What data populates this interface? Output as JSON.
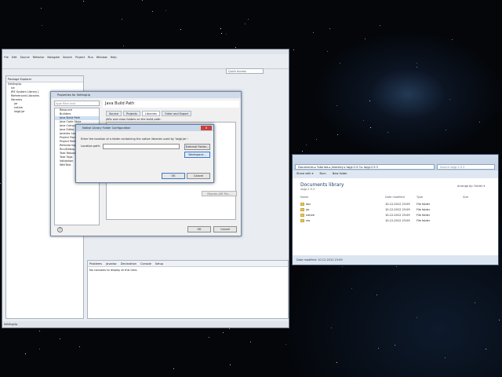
{
  "eclipse": {
    "menu": [
      "File",
      "Edit",
      "Source",
      "Refactor",
      "Navigate",
      "Search",
      "Project",
      "Run",
      "Window",
      "Help"
    ],
    "quick_access": "Quick Access",
    "package_explorer": {
      "title": "Package Explorer",
      "items": [
        {
          "label": "SettingUp",
          "indent": 2
        },
        {
          "label": "src",
          "indent": 6
        },
        {
          "label": "JRE System Library [",
          "indent": 6
        },
        {
          "label": "Referenced Libraries",
          "indent": 6
        },
        {
          "label": "libraries",
          "indent": 6
        },
        {
          "label": "jar",
          "indent": 10
        },
        {
          "label": "native",
          "indent": 10
        },
        {
          "label": "lwjgl.jar",
          "indent": 10
        }
      ]
    },
    "console": {
      "tabs": [
        "Problems",
        "Javadoc",
        "Declaration",
        "Console",
        "Setup"
      ],
      "message": "No consoles to display at this time."
    },
    "status": "SettingUp"
  },
  "properties_dialog": {
    "title": "Properties for SettingUp",
    "filter_placeholder": "type filter text",
    "categories": [
      "Resource",
      "Builders",
      "Java Build Path",
      "Java Code Style",
      "Java Compiler",
      "Java Editor",
      "Javadoc Location",
      "Project Facets",
      "Project References",
      "Refactoring History",
      "Run/Debug Settings",
      "Task Repository",
      "Task Tags",
      "Validation",
      "WikiText"
    ],
    "selected_category": "Java Build Path",
    "page_title": "Java Build Path",
    "tabs": [
      "Source",
      "Projects",
      "Libraries",
      "Order and Export"
    ],
    "active_tab": "Libraries",
    "description": "JARs and class folders on the build path:",
    "side_button": "Migrate JAR File...",
    "ok": "OK",
    "cancel": "Cancel",
    "help": "?"
  },
  "native_dialog": {
    "title": "Native Library Folder Configuration",
    "message": "Enter the location of a folder containing the native libraries used by 'lwjgl.jar':",
    "location_label": "Location path:",
    "external_folder": "External Folder...",
    "workspace": "Workspace...",
    "ok": "OK",
    "cancel": "Cancel",
    "close": "x"
  },
  "explorer": {
    "address": "Documents ▸ Tutorials ▸ Jmonkey ▸ lwjgl-2.9.3 ▸ lwjgl-2.9.3",
    "search_placeholder": "Search lwjgl-2.9.3",
    "commands": [
      "Share with ▾",
      "Burn",
      "New folder"
    ],
    "library_title": "Documents library",
    "library_sub": "lwjgl-2.9.3",
    "arrange": "Arrange by: Folder ▾",
    "columns": [
      "Name",
      "Date modified",
      "Type",
      "Size"
    ],
    "rows": [
      {
        "name": "doc",
        "date": "10-12-2012 23:09",
        "type": "File folder"
      },
      {
        "name": "jar",
        "date": "10-12-2012 23:09",
        "type": "File folder"
      },
      {
        "name": "native",
        "date": "10-12-2012 23:09",
        "type": "File folder"
      },
      {
        "name": "res",
        "date": "10-12-2012 23:09",
        "type": "File folder"
      }
    ],
    "status": "Date modified: 10-12-2012 23:09"
  }
}
